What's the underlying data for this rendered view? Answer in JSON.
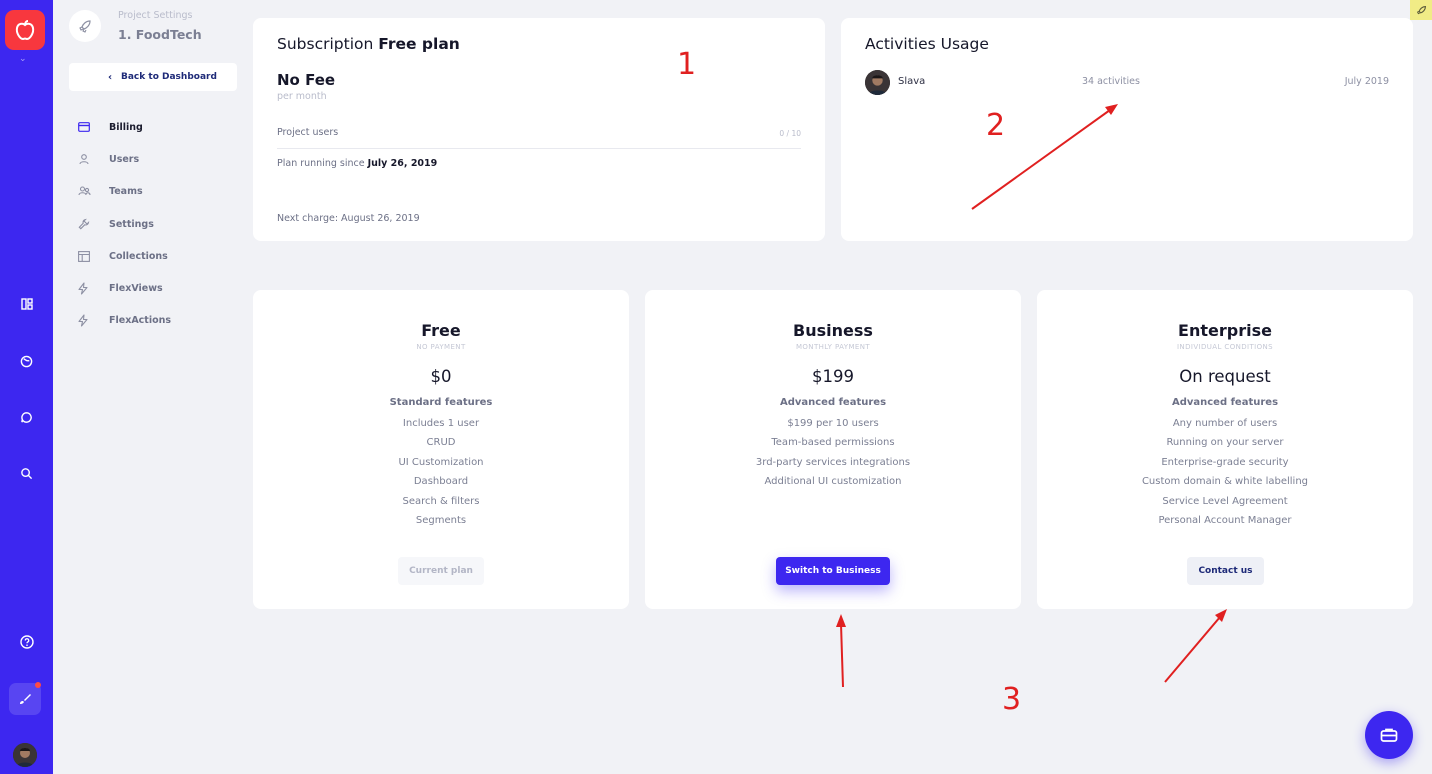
{
  "colors": {
    "accent": "#3d27f0",
    "brand_logo": "#f8373e",
    "annotation": "#e02020"
  },
  "rail": {
    "icons": [
      "apple-logo-icon",
      "dashboard-icon",
      "globe-icon",
      "chat-icon",
      "search-icon",
      "help-icon",
      "brush-icon",
      "user-avatar"
    ]
  },
  "sidebar": {
    "project_label": "Project Settings",
    "project_name": "1. FoodTech",
    "back_label": "Back to Dashboard",
    "items": [
      {
        "label": "Billing",
        "icon": "credit-card-icon",
        "active": true
      },
      {
        "label": "Users",
        "icon": "user-icon"
      },
      {
        "label": "Teams",
        "icon": "team-icon"
      },
      {
        "label": "Settings",
        "icon": "wrench-icon"
      },
      {
        "label": "Collections",
        "icon": "table-icon"
      },
      {
        "label": "FlexViews",
        "icon": "bolt-icon"
      },
      {
        "label": "FlexActions",
        "icon": "bolt-icon"
      }
    ]
  },
  "subscription": {
    "title_prefix": "Subscription",
    "plan": "Free plan",
    "fee": "No Fee",
    "fee_period": "per month",
    "project_users_label": "Project users",
    "project_users_value": "0 / 10",
    "since_label": "Plan running since",
    "since_date": "July 26, 2019",
    "next_charge": "Next charge: August 26, 2019"
  },
  "activities": {
    "title": "Activities Usage",
    "rows": [
      {
        "name": "Slava",
        "count": "34 activities",
        "period": "July 2019"
      }
    ]
  },
  "plans": [
    {
      "name": "Free",
      "subtitle": "NO PAYMENT",
      "price": "$0",
      "features_title": "Standard features",
      "features": [
        "Includes 1 user",
        "CRUD",
        "UI Customization",
        "Dashboard",
        "Search & filters",
        "Segments"
      ],
      "button": "Current plan"
    },
    {
      "name": "Business",
      "subtitle": "MONTHLY PAYMENT",
      "price": "$199",
      "features_title": "Advanced features",
      "features": [
        "$199 per 10 users",
        "Team-based permissions",
        "3rd-party services integrations",
        "Additional UI customization"
      ],
      "button": "Switch to Business"
    },
    {
      "name": "Enterprise",
      "subtitle": "INDIVIDUAL CONDITIONS",
      "price": "On request",
      "features_title": "Advanced features",
      "features": [
        "Any number of users",
        "Running on your server",
        "Enterprise-grade security",
        "Custom domain & white labelling",
        "Service Level Agreement",
        "Personal Account Manager"
      ],
      "button": "Contact us"
    }
  ],
  "annotations": [
    "1",
    "2",
    "3"
  ]
}
